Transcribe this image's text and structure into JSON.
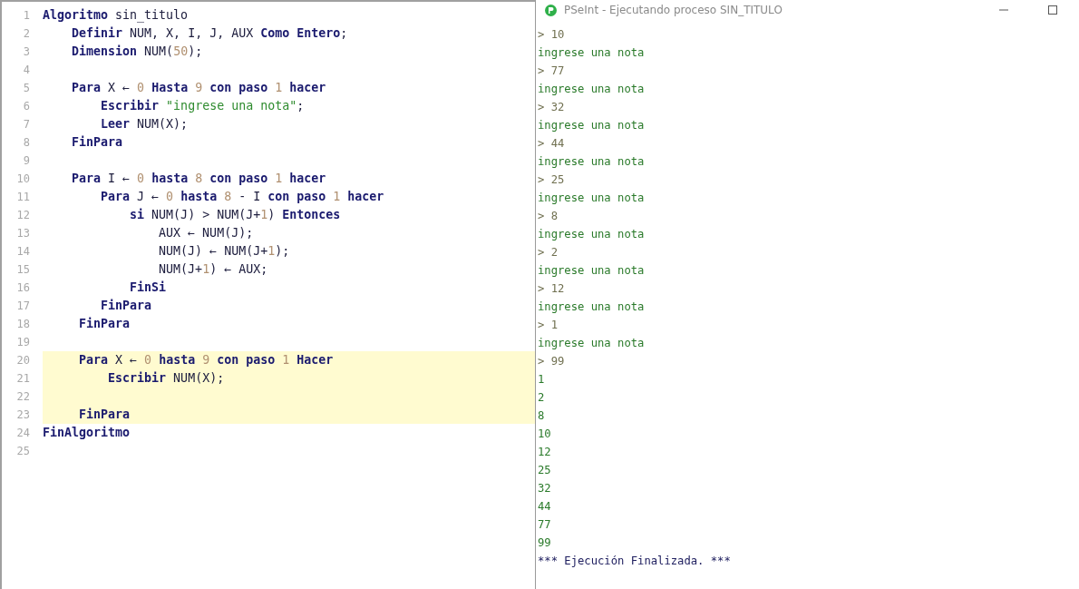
{
  "editor": {
    "lines": [
      {
        "number": "1",
        "text": "**Algoritmo** sin_titulo",
        "highlighted": false
      },
      {
        "number": "2",
        "text": "    **Definir** NUM, X, I, J, AUX **Como Entero**;",
        "highlighted": false
      },
      {
        "number": "3",
        "text": "    **Dimension** NUM(50);",
        "highlighted": false
      },
      {
        "number": "4",
        "highlighted": false
      },
      {
        "number": "5",
        "text": "    **Para** X ← 0 **Hasta** 9 **con paso** 1 **hacer**",
        "highlighted": false
      },
      {
        "number": "6",
        "text": "        **Escribir** \"ingrese una nota\";",
        "highlighted": false
      },
      {
        "number": "7",
        "text": "        **Leer** NUM(X);",
        "highlighted": false
      },
      {
        "number": "8",
        "text": "    **FinPara**",
        "highlighted": false
      },
      {
        "number": "9",
        "highlighted": false
      },
      {
        "number": "10",
        "text": "    **Para** I ← 0 **hasta** 8 **con paso** 1 **hacer**",
        "highlighted": false
      },
      {
        "number": "11",
        "text": "        **Para** J ← 0 **hasta** 8 - I **con paso** 1 **hacer**",
        "highlighted": false
      },
      {
        "number": "12",
        "text": "            **si** NUM(J) > NUM(J+1) **Entonces**",
        "highlighted": false
      },
      {
        "number": "13",
        "text": "                AUX ← NUM(J);",
        "highlighted": false
      },
      {
        "number": "14",
        "text": "                NUM(J) ← NUM(J+1);",
        "highlighted": false
      },
      {
        "number": "15",
        "text": "                NUM(J+1) ← AUX;",
        "highlighted": false
      },
      {
        "number": "16",
        "text": "            **FinSi**",
        "highlighted": false
      },
      {
        "number": "17",
        "text": "        **FinPara**",
        "highlighted": false
      },
      {
        "number": "18",
        "text": "     **FinPara**",
        "highlighted": false
      },
      {
        "number": "19",
        "highlighted": false
      },
      {
        "number": "20",
        "text": "     **Para** X ← 0 **hasta** 9 **con paso** 1 **Hacer**",
        "highlighted": true
      },
      {
        "number": "21",
        "text": "         **Escribir** NUM(X);",
        "highlighted": true
      },
      {
        "number": "22",
        "highlighted": true
      },
      {
        "number": "23",
        "text": "     **FinPara**",
        "highlighted": true
      },
      {
        "number": "24",
        "text": "**FinAlgoritmo**",
        "highlighted": false
      },
      {
        "number": "25",
        "highlighted": false
      }
    ]
  },
  "console": {
    "title": "PSeInt - Ejecutando proceso SIN_TITULO",
    "lines": [
      {
        "kind": "input",
        "text": "> 10"
      },
      {
        "kind": "output",
        "text": "ingrese una nota"
      },
      {
        "kind": "input",
        "text": "> 77"
      },
      {
        "kind": "output",
        "text": "ingrese una nota"
      },
      {
        "kind": "input",
        "text": "> 32"
      },
      {
        "kind": "output",
        "text": "ingrese una nota"
      },
      {
        "kind": "input",
        "text": "> 44"
      },
      {
        "kind": "output",
        "text": "ingrese una nota"
      },
      {
        "kind": "input",
        "text": "> 25"
      },
      {
        "kind": "output",
        "text": "ingrese una nota"
      },
      {
        "kind": "input",
        "text": "> 8"
      },
      {
        "kind": "output",
        "text": "ingrese una nota"
      },
      {
        "kind": "input",
        "text": "> 2"
      },
      {
        "kind": "output",
        "text": "ingrese una nota"
      },
      {
        "kind": "input",
        "text": "> 12"
      },
      {
        "kind": "output",
        "text": "ingrese una nota"
      },
      {
        "kind": "input",
        "text": "> 1"
      },
      {
        "kind": "output",
        "text": "ingrese una nota"
      },
      {
        "kind": "input",
        "text": "> 99"
      },
      {
        "kind": "output",
        "text": "1"
      },
      {
        "kind": "output",
        "text": "2"
      },
      {
        "kind": "output",
        "text": "8"
      },
      {
        "kind": "output",
        "text": "10"
      },
      {
        "kind": "output",
        "text": "12"
      },
      {
        "kind": "output",
        "text": "25"
      },
      {
        "kind": "output",
        "text": "32"
      },
      {
        "kind": "output",
        "text": "44"
      },
      {
        "kind": "output",
        "text": "77"
      },
      {
        "kind": "output",
        "text": "99"
      },
      {
        "kind": "status",
        "text": "*** Ejecución Finalizada. ***"
      }
    ]
  }
}
